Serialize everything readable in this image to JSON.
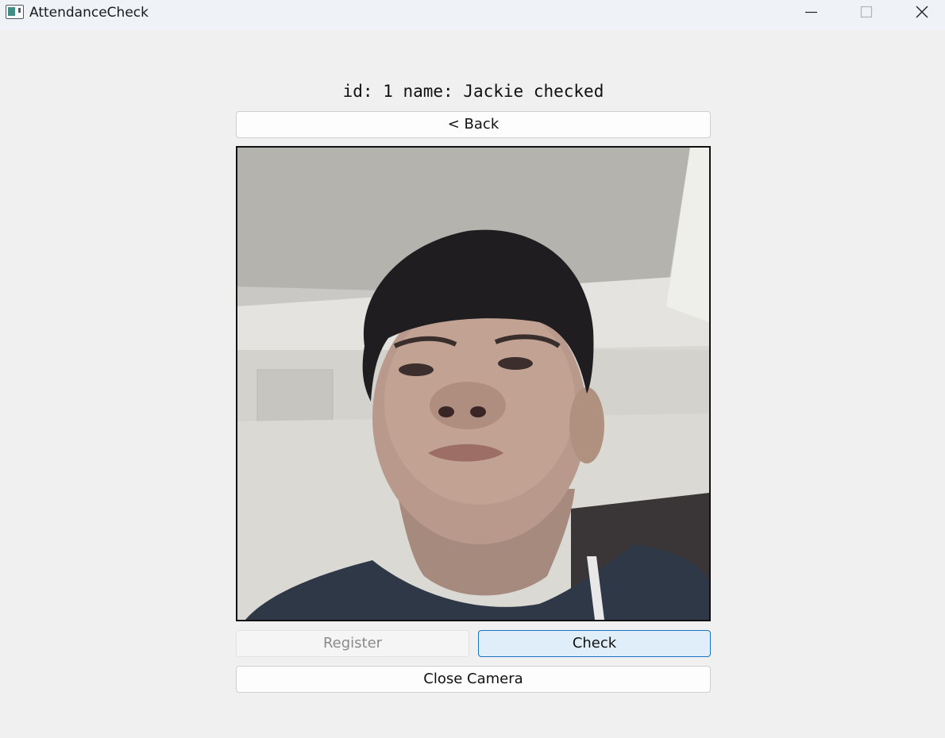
{
  "window": {
    "title": "AttendanceCheck",
    "icon": "app-window-icon",
    "controls": [
      "minimize-icon",
      "maximize-icon",
      "close-icon"
    ]
  },
  "status": {
    "text": "id: 1 name: Jackie checked"
  },
  "buttons": {
    "back": "< Back",
    "register": "Register",
    "check": "Check",
    "close_camera": "Close Camera"
  },
  "camera": {
    "content": "live-camera-feed-icon"
  },
  "colors": {
    "check_accent": "#1a73c7",
    "check_bg": "#e0eef9",
    "disabled_text": "#8a8a8a"
  }
}
